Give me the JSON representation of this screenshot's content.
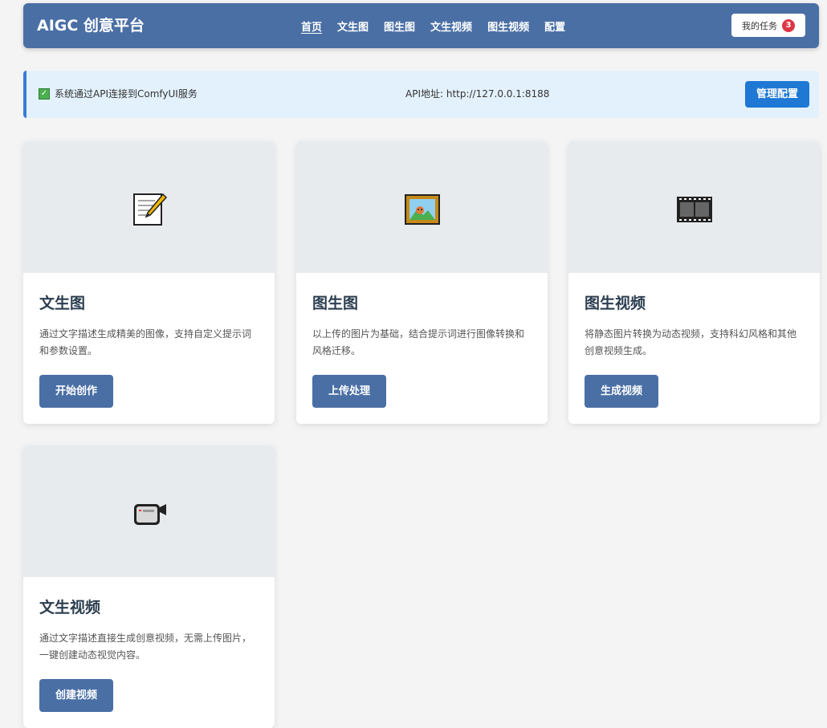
{
  "navbar": {
    "brand": "AIGC 创意平台",
    "links": [
      "首页",
      "文生图",
      "图生图",
      "文生视频",
      "图生视频",
      "配置"
    ],
    "tasks_label": "我的任务",
    "tasks_count": "3"
  },
  "status": {
    "message": "系统通过API连接到ComfyUI服务",
    "api": "API地址: http://127.0.0.1:8188",
    "manage_label": "管理配置"
  },
  "cards": [
    {
      "icon": "memo-pencil-icon",
      "title": "文生图",
      "desc": "通过文字描述生成精美的图像，支持自定义提示词和参数设置。",
      "button": "开始创作"
    },
    {
      "icon": "framed-picture-icon",
      "title": "图生图",
      "desc": "以上传的图片为基础，结合提示词进行图像转换和风格迁移。",
      "button": "上传处理"
    },
    {
      "icon": "film-frames-icon",
      "title": "图生视频",
      "desc": "将静态图片转换为动态视频，支持科幻风格和其他创意视频生成。",
      "button": "生成视频"
    },
    {
      "icon": "video-camera-icon",
      "title": "文生视频",
      "desc": "通过文字描述直接生成创意视频，无需上传图片，一键创建动态视觉内容。",
      "button": "创建视频"
    }
  ],
  "colors": {
    "primary": "#4a6fa5",
    "accent": "#1e78d4",
    "badge": "#dc3545",
    "status_bg": "#e3f1fc"
  }
}
